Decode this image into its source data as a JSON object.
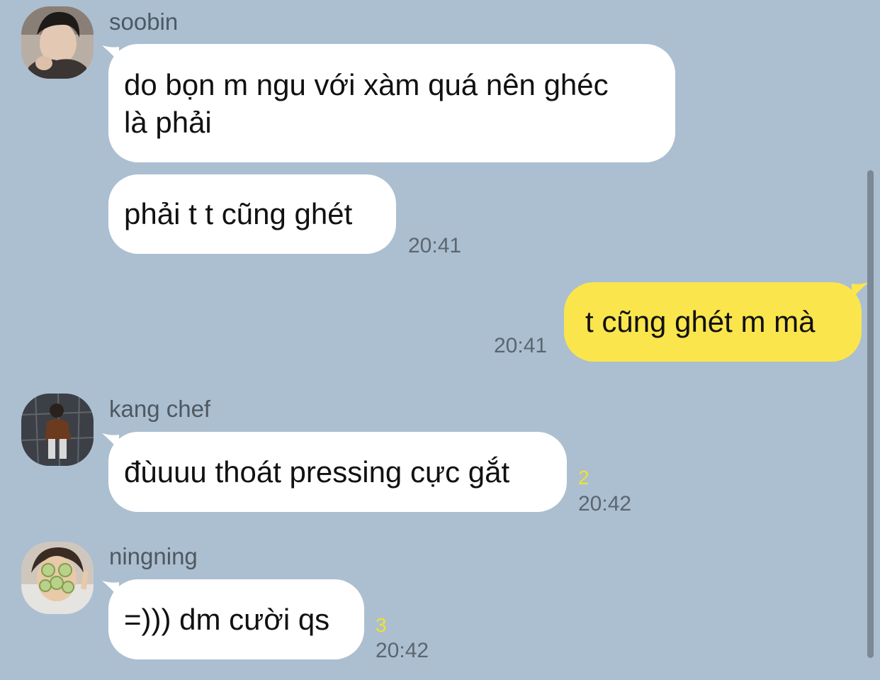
{
  "chat": {
    "colors": {
      "background": "#abbfd0",
      "incoming_bubble": "#ffffff",
      "outgoing_bubble": "#fae54d",
      "unread_count": "#f2e12e"
    },
    "messages": [
      {
        "sender": "soobin",
        "avatar": "soobin-avatar",
        "bubbles": [
          "do bọn m ngu với xàm quá nên ghéc\nlà phải",
          "phải t t cũng ghét"
        ],
        "time": "20:41"
      },
      {
        "sender": "me",
        "bubbles": [
          "t cũng ghét m mà"
        ],
        "time": "20:41"
      },
      {
        "sender": "kang chef",
        "avatar": "kang-chef-avatar",
        "bubbles": [
          "đùuuu thoát pressing cực gắt"
        ],
        "unread": "2",
        "time": "20:42"
      },
      {
        "sender": "ningning",
        "avatar": "ningning-avatar",
        "bubbles": [
          "=))) dm cười qs"
        ],
        "unread": "3",
        "time": "20:42"
      }
    ]
  }
}
